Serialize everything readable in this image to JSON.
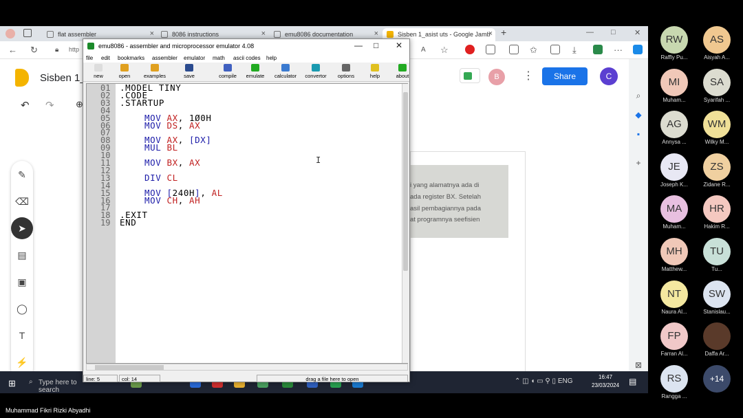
{
  "browser": {
    "tabs": [
      {
        "label": "flat assembler"
      },
      {
        "label": "8086 instructions"
      },
      {
        "label": "emu8086 documentation"
      },
      {
        "label": "Sisben 1_asist uts - Google Jamb"
      }
    ],
    "new_tab": "+",
    "address_partial": "http"
  },
  "jamboard": {
    "title": "Sisben 1_a",
    "avatar_b": "B",
    "share_label": "Share",
    "avatar_c": "C",
    "photo_lines": [
      "i yang alamatnya ada di",
      "ada register BX. Setelah",
      "asil pembagiannya pada",
      "at programnya seefisien"
    ]
  },
  "emu": {
    "title": "emu8086 - assembler and microprocessor emulator 4.08",
    "menu": [
      "file",
      "edit",
      "bookmarks",
      "assembler",
      "emulator",
      "math",
      "ascii codes",
      "help"
    ],
    "toolbar": [
      {
        "label": "new",
        "color": "#ddd"
      },
      {
        "label": "open",
        "color": "#e0a020"
      },
      {
        "label": "examples",
        "color": "#e0a020"
      },
      {
        "label": "save",
        "color": "#2b4b8f"
      },
      {
        "label": "compile",
        "color": "#4060c0"
      },
      {
        "label": "emulate",
        "color": "#22aa22"
      },
      {
        "label": "calculator",
        "color": "#3a7ad0"
      },
      {
        "label": "convertor",
        "color": "#1a9ab0"
      },
      {
        "label": "options",
        "color": "#666"
      },
      {
        "label": "help",
        "color": "#e0c020"
      },
      {
        "label": "about",
        "color": "#22aa22"
      }
    ],
    "line_numbers": [
      "01",
      "02",
      "03",
      "04",
      "05",
      "06",
      "07",
      "08",
      "09",
      "10",
      "11",
      "12",
      "13",
      "14",
      "15",
      "16",
      "17",
      "18",
      "19"
    ],
    "code": [
      {
        "parts": [
          {
            "t": ".MODEL TINY",
            "c": "#000"
          }
        ],
        "indent": 0
      },
      {
        "parts": [
          {
            "t": ".CODE",
            "c": "#000"
          }
        ],
        "indent": 0
      },
      {
        "parts": [
          {
            "t": ".STARTUP",
            "c": "#000"
          }
        ],
        "indent": 0
      },
      {
        "parts": [],
        "indent": 0
      },
      {
        "parts": [
          {
            "t": "MOV ",
            "c": "#1a1aa8"
          },
          {
            "t": "AX",
            "c": "#c02020"
          },
          {
            "t": ", ",
            "c": "#000"
          },
          {
            "t": "1Ø0H",
            "c": "#000"
          }
        ],
        "indent": 1
      },
      {
        "parts": [
          {
            "t": "MOV ",
            "c": "#1a1aa8"
          },
          {
            "t": "DS",
            "c": "#c02020"
          },
          {
            "t": ", ",
            "c": "#000"
          },
          {
            "t": "AX",
            "c": "#c02020"
          }
        ],
        "indent": 1
      },
      {
        "parts": [],
        "indent": 0
      },
      {
        "parts": [
          {
            "t": "MOV ",
            "c": "#1a1aa8"
          },
          {
            "t": "AX",
            "c": "#c02020"
          },
          {
            "t": ", ",
            "c": "#000"
          },
          {
            "t": "[DX]",
            "c": "#1a1aa8"
          }
        ],
        "indent": 1
      },
      {
        "parts": [
          {
            "t": "MUL ",
            "c": "#1a1aa8"
          },
          {
            "t": "BL",
            "c": "#c02020"
          }
        ],
        "indent": 1
      },
      {
        "parts": [],
        "indent": 0
      },
      {
        "parts": [
          {
            "t": "MOV ",
            "c": "#1a1aa8"
          },
          {
            "t": "BX",
            "c": "#c02020"
          },
          {
            "t": ", ",
            "c": "#000"
          },
          {
            "t": "AX",
            "c": "#c02020"
          }
        ],
        "indent": 1
      },
      {
        "parts": [],
        "indent": 0
      },
      {
        "parts": [
          {
            "t": "DIV ",
            "c": "#1a1aa8"
          },
          {
            "t": "CL",
            "c": "#c02020"
          }
        ],
        "indent": 1
      },
      {
        "parts": [],
        "indent": 0
      },
      {
        "parts": [
          {
            "t": "MOV ",
            "c": "#1a1aa8"
          },
          {
            "t": "[",
            "c": "#1a1aa8"
          },
          {
            "t": "240H",
            "c": "#000"
          },
          {
            "t": "]",
            "c": "#1a1aa8"
          },
          {
            "t": ", ",
            "c": "#000"
          },
          {
            "t": "AL",
            "c": "#c02020"
          }
        ],
        "indent": 1
      },
      {
        "parts": [
          {
            "t": "MOV ",
            "c": "#1a1aa8"
          },
          {
            "t": "CH",
            "c": "#c02020"
          },
          {
            "t": ", ",
            "c": "#000"
          },
          {
            "t": "AH",
            "c": "#c02020"
          }
        ],
        "indent": 1
      },
      {
        "parts": [],
        "indent": 0
      },
      {
        "parts": [
          {
            "t": ".EXIT",
            "c": "#000"
          }
        ],
        "indent": 0
      },
      {
        "parts": [
          {
            "t": "END",
            "c": "#000"
          }
        ],
        "indent": 0
      }
    ],
    "status_line": "line: 5",
    "status_col": "col: 14",
    "status_drag": "drag a file here to open"
  },
  "taskbar": {
    "search_label": "Type here to search",
    "lang": "ENG",
    "time": "16:47",
    "date": "23/03/2024"
  },
  "participants": [
    {
      "initials": "RW",
      "name": "Raffly Pu...",
      "color": "#c8d8b0"
    },
    {
      "initials": "AS",
      "name": "Aisyah A...",
      "color": "#f0c890"
    },
    {
      "initials": "MI",
      "name": "Muham...",
      "color": "#f0c8b8"
    },
    {
      "initials": "SA",
      "name": "Syarifah ...",
      "color": "#dcdcd0"
    },
    {
      "initials": "AG",
      "name": "Annysa ...",
      "color": "#dcdcd0"
    },
    {
      "initials": "WM",
      "name": "Wilky M...",
      "color": "#f0e098"
    },
    {
      "initials": "JE",
      "name": "Joseph K...",
      "color": "#e8e8f4"
    },
    {
      "initials": "ZS",
      "name": "Zidane R...",
      "color": "#f0d0a0"
    },
    {
      "initials": "MA",
      "name": "Muham...",
      "color": "#e8c0e0"
    },
    {
      "initials": "HR",
      "name": "Hakim R...",
      "color": "#f4c8c0"
    },
    {
      "initials": "MH",
      "name": "Matthew...",
      "color": "#f0c8b8"
    },
    {
      "initials": "TU",
      "name": "Tu...",
      "color": "#c8e0d8"
    },
    {
      "initials": "NT",
      "name": "Naura Al...",
      "color": "#f4e8a0"
    },
    {
      "initials": "SW",
      "name": "Stanislau...",
      "color": "#dce4f0"
    },
    {
      "initials": "FP",
      "name": "Farran Al...",
      "color": "#f0c8c8"
    },
    {
      "initials": "",
      "name": "Daffa Ar...",
      "color": "#5a3a2a"
    },
    {
      "initials": "RS",
      "name": "Rangga ...",
      "color": "#dce4f0"
    },
    {
      "initials": "+14",
      "name": "",
      "color": "#3c4a6a"
    }
  ],
  "footer_name": "Muhammad Fikri Rizki Abyadhi"
}
